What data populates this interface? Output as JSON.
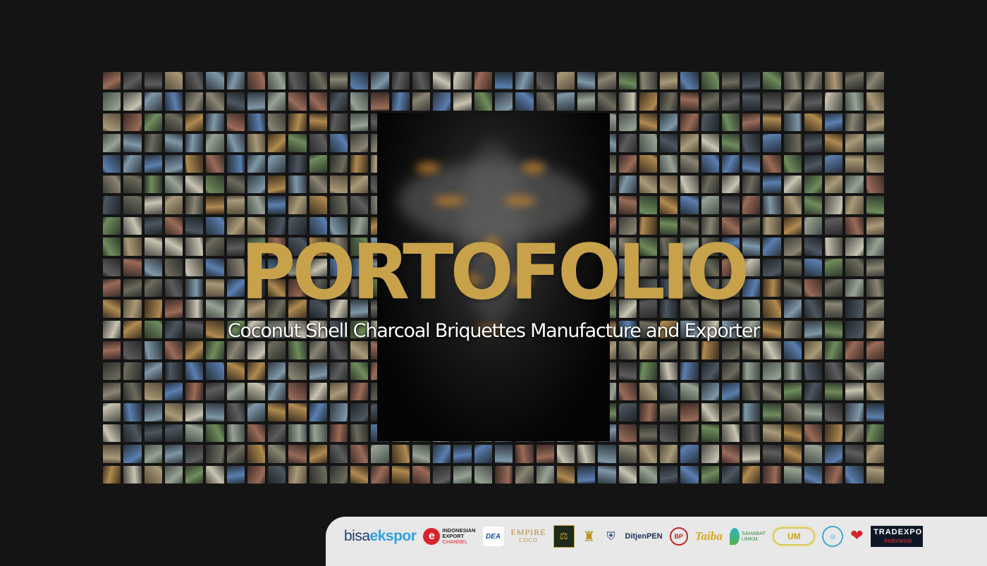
{
  "title": "PORTOFOLIO",
  "subtitle": "Coconut Shell Charcoal Briquettes Manufacture and Exporter",
  "colors": {
    "background": "#141414",
    "title_gold": "#c7a24b",
    "subtitle": "#ffffff",
    "partner_bar": "#e8e8e8"
  },
  "partners": {
    "bisaekspor_a": "bisa",
    "bisaekspor_b": "ekspor",
    "iec_mark": "e",
    "iec_line1": "INDONESIAN",
    "iec_line2": "EXPORT",
    "iec_line3": "CHANNEL",
    "dea": "DEA",
    "empire_line1": "EMPIRE",
    "empire_line2": "COCO",
    "ditjen_line1": "DitjenPEN",
    "bp": "BP",
    "taiba": "Taiba",
    "sahabat_line1": "SAHABAT",
    "sahabat_line2": "UMKM",
    "um": "UM",
    "tradexpo_line1": "TRADEXPO",
    "tradexpo_line2": "Indonesia"
  }
}
